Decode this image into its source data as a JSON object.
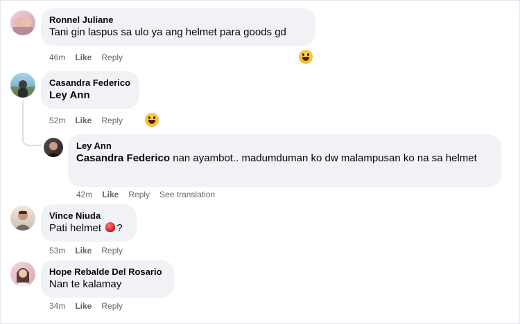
{
  "comments": [
    {
      "author": "Ronnel Juliane",
      "text": "Tani gin laspus sa ulo ya ang helmet para goods gd",
      "time": "46m",
      "like": "Like",
      "reply": "Reply",
      "reaction": "laughing-face"
    },
    {
      "author": "Casandra Federico",
      "text": "Ley Ann",
      "time": "52m",
      "like": "Like",
      "reply": "Reply",
      "reaction": "laughing-face"
    },
    {
      "author": "Ley Ann",
      "mention": "Casandra Federico",
      "text": " nan ayambot.. madumduman ko dw malampusan ko na sa helmet",
      "time": "42m",
      "like": "Like",
      "reply": "Reply",
      "see_translation": "See translation"
    },
    {
      "author": "Vince Niuda",
      "text_before": "Pati helmet ",
      "text_after": "?",
      "emoji": "helmet-emoji",
      "time": "53m",
      "like": "Like",
      "reply": "Reply"
    },
    {
      "author": "Hope Rebalde Del Rosario",
      "text": "Nan te kalamay",
      "time": "34m",
      "like": "Like",
      "reply": "Reply"
    }
  ],
  "colors": {
    "bubble": "#f0f2f5",
    "meta": "#65676b",
    "text": "#050505"
  }
}
